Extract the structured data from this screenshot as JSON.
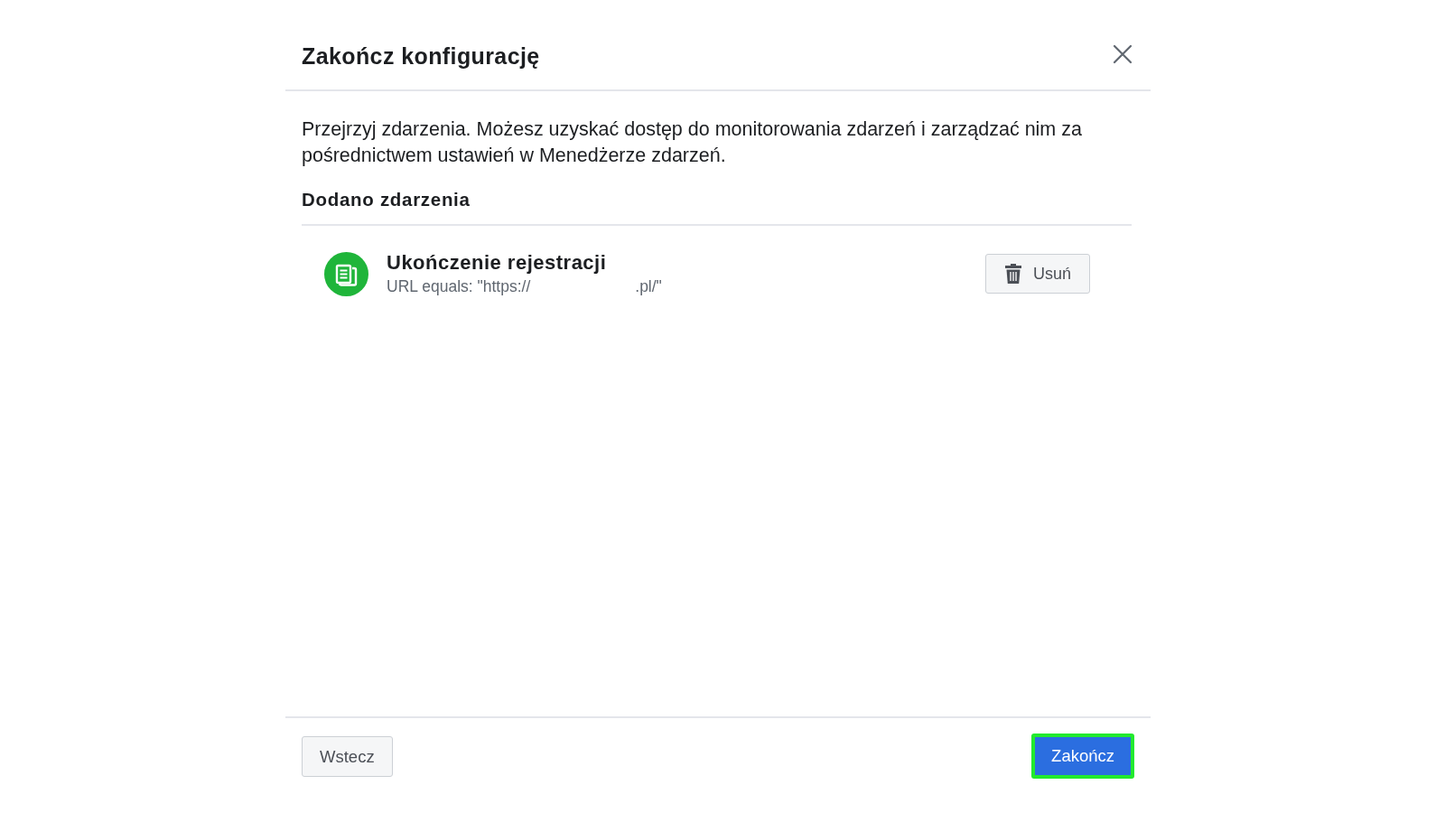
{
  "dialog": {
    "title": "Zakończ konfigurację",
    "intro": "Przejrzyj zdarzenia. Możesz uzyskać dostęp do monitorowania zdarzeń i zarządzać nim za pośrednictwem ustawień w Menedżerze zdarzeń.",
    "section": {
      "heading": "Dodano zdarzenia",
      "events": [
        {
          "name": "Ukończenie rejestracji",
          "rule_start": "URL equals: \"https://",
          "rule_end": ".pl/\"",
          "remove_button": "Usuń"
        }
      ]
    },
    "footer": {
      "buttons": [
        {
          "label": "Wstecz",
          "kind": "secondary",
          "highlighted": false
        },
        {
          "label": "Zakończ",
          "kind": "primary",
          "highlighted": true
        }
      ]
    }
  }
}
